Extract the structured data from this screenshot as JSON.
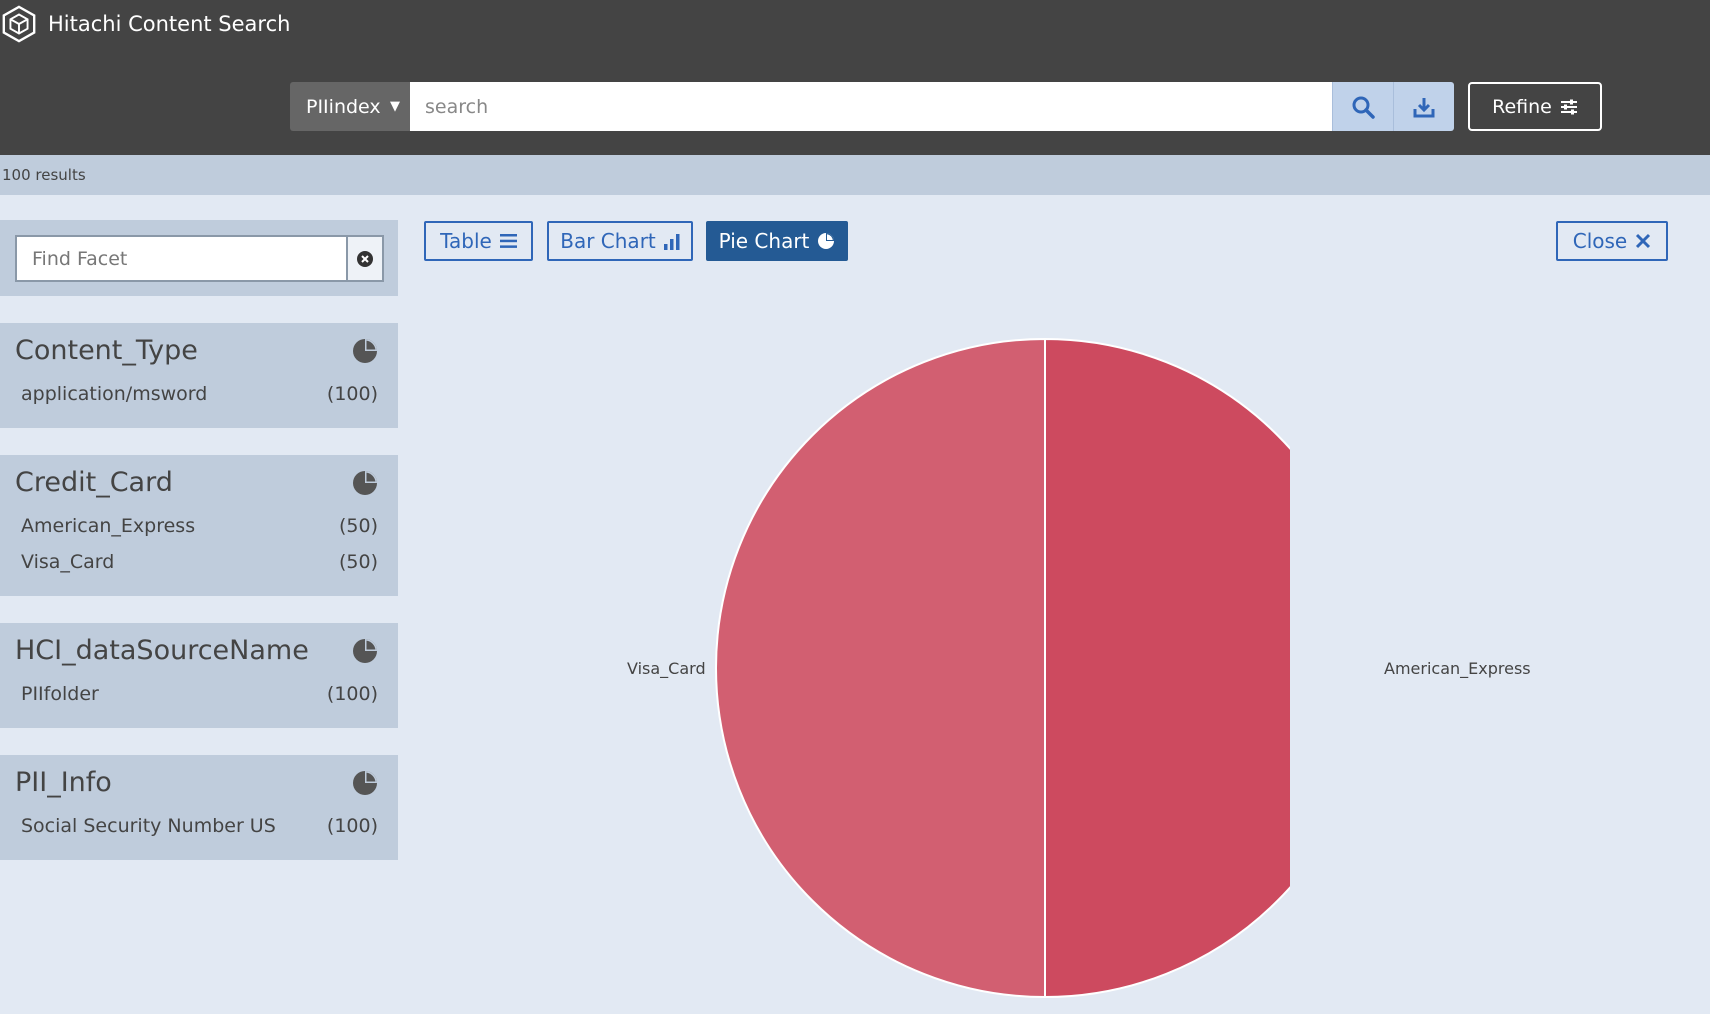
{
  "header": {
    "app_title": "Hitachi Content Search",
    "logo_icon": "hexagon-cube-icon",
    "index_selected": "PIIindex",
    "search_placeholder": "search",
    "search_value": "",
    "search_icon": "magnifier-icon",
    "download_icon": "download-icon",
    "refine_label": "Refine",
    "refine_icon": "sliders-icon"
  },
  "results": {
    "count_text": "100 results"
  },
  "sidebar": {
    "find_facet_placeholder": "Find Facet",
    "facets": [
      {
        "title": "Content_Type",
        "rows": [
          {
            "label": "application/msword",
            "count": "(100)"
          }
        ]
      },
      {
        "title": "Credit_Card",
        "rows": [
          {
            "label": "American_Express",
            "count": "(50)"
          },
          {
            "label": "Visa_Card",
            "count": "(50)"
          }
        ]
      },
      {
        "title": "HCI_dataSourceName",
        "rows": [
          {
            "label": "PIIfolder",
            "count": "(100)"
          }
        ]
      },
      {
        "title": "PII_Info",
        "rows": [
          {
            "label": "Social Security Number US",
            "count": "(100)"
          }
        ]
      }
    ]
  },
  "toolbar": {
    "table_label": "Table",
    "bar_chart_label": "Bar Chart",
    "pie_chart_label": "Pie Chart",
    "close_label": "Close",
    "active_view": "Pie Chart"
  },
  "chart_data": {
    "type": "pie",
    "categories": [
      "American_Express",
      "Visa_Card"
    ],
    "values": [
      50,
      50
    ],
    "colors": [
      "#cd4a5f",
      "#d25f71"
    ],
    "title": ""
  },
  "colors": {
    "header_bg": "#444444",
    "accent": "#2f66b8",
    "active_button": "#245a94",
    "panel_bg": "#bfccdc",
    "page_bg": "#e2e9f3"
  }
}
